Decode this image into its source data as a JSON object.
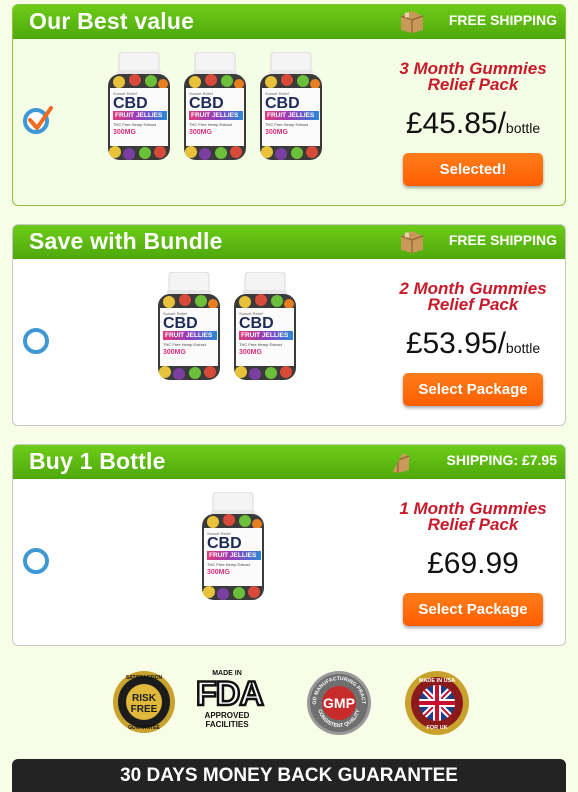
{
  "packages": [
    {
      "title": "Our Best value",
      "shipping": "FREE SHIPPING",
      "name_line1": "3 Month Gummies",
      "name_line2": "Relief Pack",
      "price": "£45.85",
      "per": "bottle",
      "button": "Selected!",
      "selected": true,
      "bottle_count": 3
    },
    {
      "title": "Save with Bundle",
      "shipping": "FREE SHIPPING",
      "name_line1": "2 Month Gummies",
      "name_line2": "Relief Pack",
      "price": "£53.95",
      "per": "bottle",
      "button": "Select Package",
      "selected": false,
      "bottle_count": 2
    },
    {
      "title": "Buy 1 Bottle",
      "shipping": "SHIPPING: £7.95",
      "name_line1": "1 Month Gummies",
      "name_line2": "Relief Pack",
      "price": "£69.99",
      "per": "",
      "button": "Select Package",
      "selected": false,
      "bottle_count": 1
    }
  ],
  "bottle_label": {
    "brand": "Sunset Relief",
    "cbd": "CBD",
    "product": "FRUIT JELLIES",
    "tagline": "THC Free Hemp Extract",
    "dose": "300MG"
  },
  "badges": {
    "risk_free_top": "SATISFACTION",
    "risk_free_line1": "RISK",
    "risk_free_line2": "FREE",
    "risk_free_bottom": "GUARANTEE",
    "fda_top": "MADE IN",
    "fda_mark": "FDA",
    "fda_line1": "APPROVED",
    "fda_line2": "FACILITIES",
    "gmp_mark": "GMP",
    "gmp_ring_top": "GOOD MANUFACTURING PRACTICE",
    "gmp_ring_bottom": "CONSISTENT QUALITY",
    "usa_top": "MADE IN USA",
    "usa_bottom": "FOR UK"
  },
  "guarantee": "30 DAYS MONEY BACK GUARANTEE",
  "colors": {
    "header_green": "#5bb810",
    "offer_red": "#c71b2b",
    "button_orange": "#ff6a08",
    "radio_blue": "#3e98d6",
    "check_orange": "#f26a1b"
  }
}
